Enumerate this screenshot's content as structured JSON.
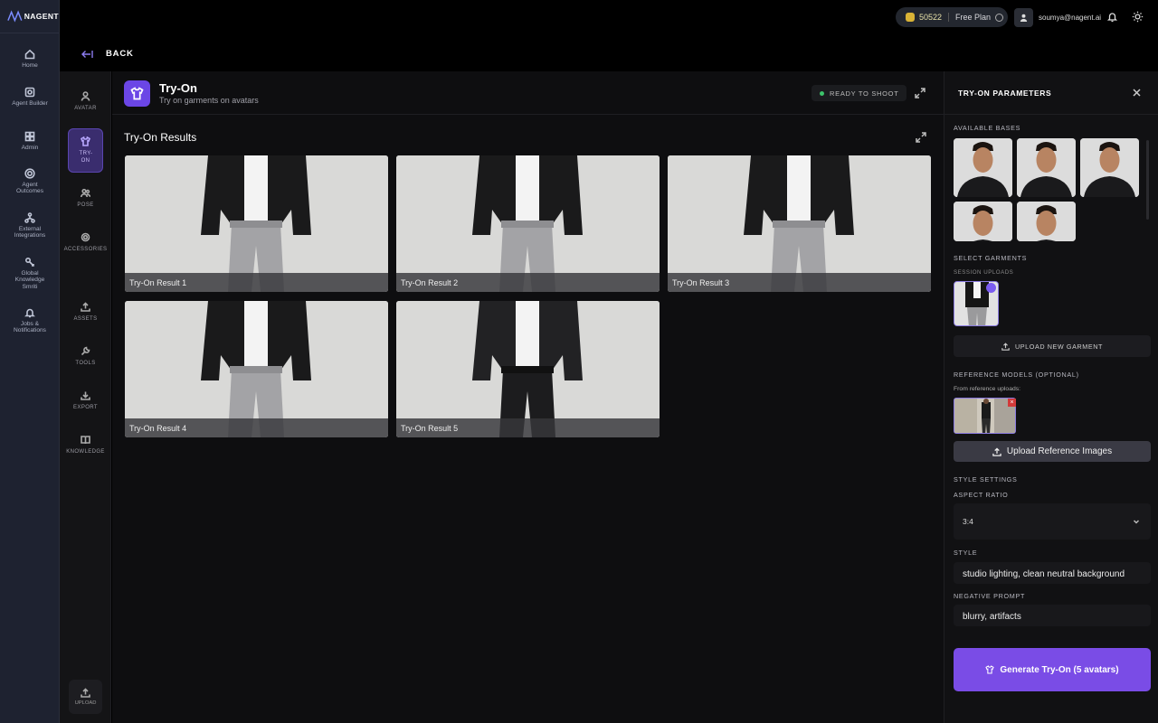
{
  "app": {
    "brand": "NAGENT"
  },
  "topbar": {
    "credits": "50522",
    "plan": "Free Plan",
    "user_email": "soumya@nagent.ai"
  },
  "nav": {
    "back_label": "BACK",
    "rail": [
      "Home",
      "Agent Builder",
      "Admin",
      "Agent Outcomes",
      "External Integrations",
      "Global Knowledge Smriti",
      "Jobs & Notifications"
    ],
    "sub": [
      "AVATAR",
      "TRY-ON",
      "POSE",
      "ACCESSORIES",
      "ASSETS",
      "TOOLS",
      "EXPORT",
      "KNOWLEDGE"
    ],
    "upload": "UPLOAD"
  },
  "header": {
    "title": "Try-On",
    "subtitle": "Try on garments on avatars",
    "status": "READY TO SHOOT"
  },
  "results": {
    "title": "Try-On Results",
    "items": [
      "Try-On Result 1",
      "Try-On Result 2",
      "Try-On Result 3",
      "Try-On Result 4",
      "Try-On Result 5"
    ]
  },
  "panel": {
    "title": "TRY-ON PARAMETERS",
    "available_bases": "AVAILABLE BASES",
    "select_garments": "SELECT GARMENTS",
    "session_uploads": "SESSION UPLOADS",
    "upload_garment": "UPLOAD NEW GARMENT",
    "reference_models": "REFERENCE MODELS (OPTIONAL)",
    "from_reference": "From reference uploads:",
    "upload_reference": "Upload Reference Images",
    "style_settings": "STYLE SETTINGS",
    "aspect_ratio_label": "ASPECT RATIO",
    "aspect_ratio_value": "3:4",
    "style_label": "STYLE",
    "style_value": "studio lighting, clean neutral background",
    "negative_label": "NEGATIVE PROMPT",
    "negative_value": "blurry, artifacts",
    "generate": "Generate Try-On (5 avatars)"
  },
  "colors": {
    "accent": "#7a4ce6",
    "rail": "#1e2230",
    "ready_dot": "#3cc36a"
  }
}
